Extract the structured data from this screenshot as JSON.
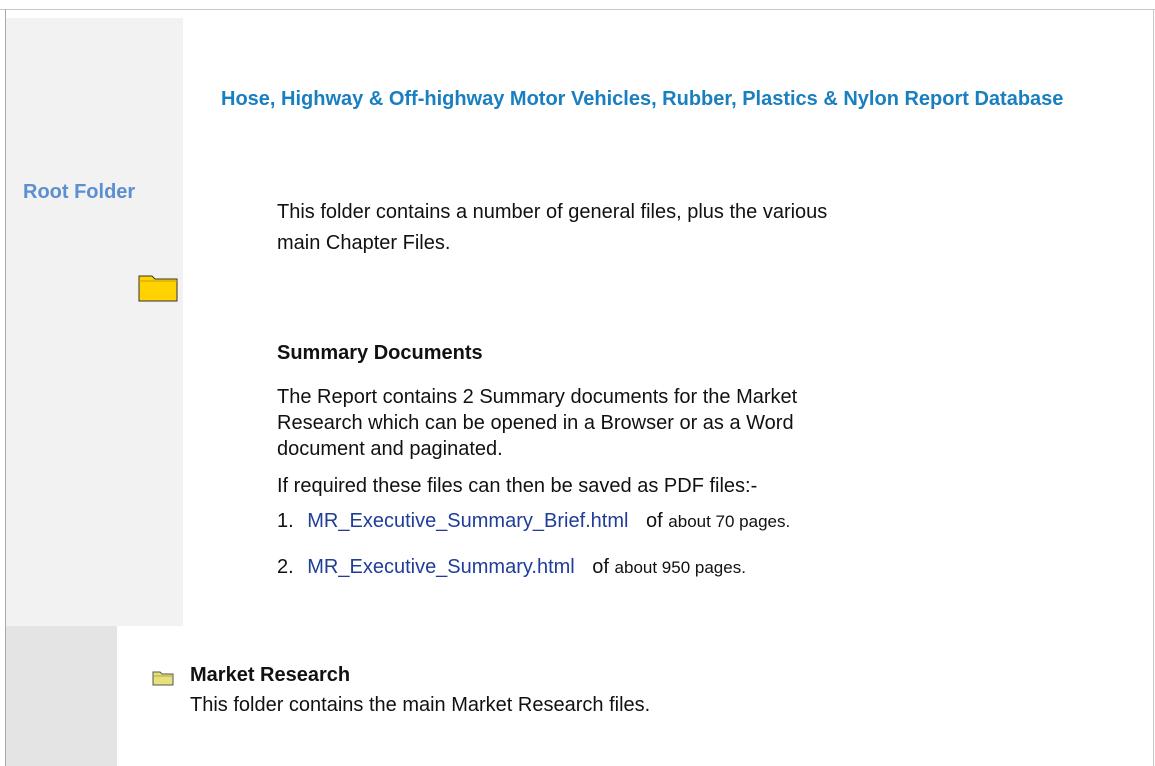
{
  "page": {
    "title": "Hose, Highway & Off-highway Motor Vehicles, Rubber, Plastics & Nylon Report Database",
    "root_folder_label": "Root Folder",
    "intro_text": "This folder contains a number of general files, plus the various main Chapter Files.",
    "summary_heading": "Summary Documents",
    "summary_text": "The Report contains 2 Summary documents for the Market Research which can be opened in a Browser or as a Word document and paginated.",
    "pdf_note": "If required these files can then be saved as PDF files:-",
    "documents": [
      {
        "number": "1.",
        "link": "MR_Executive_Summary_Brief.html",
        "of": "of",
        "pages": "about 70 pages."
      },
      {
        "number": "2.",
        "link": "MR_Executive_Summary.html",
        "of": "of",
        "pages": "about 950 pages."
      }
    ],
    "market_research": {
      "heading": "Market Research",
      "description": "This folder contains the main Market Research files."
    }
  },
  "icons": {
    "root_folder": "folder-icon",
    "market_research_folder": "folder-icon"
  },
  "colors": {
    "title": "#1a7fc1",
    "root_label": "#5b8fd0",
    "link": "#1f3d99",
    "side_panel": "#f2f2f2",
    "side_panel_lower": "#e4e4e4",
    "folder_fill": "#ffd200"
  }
}
